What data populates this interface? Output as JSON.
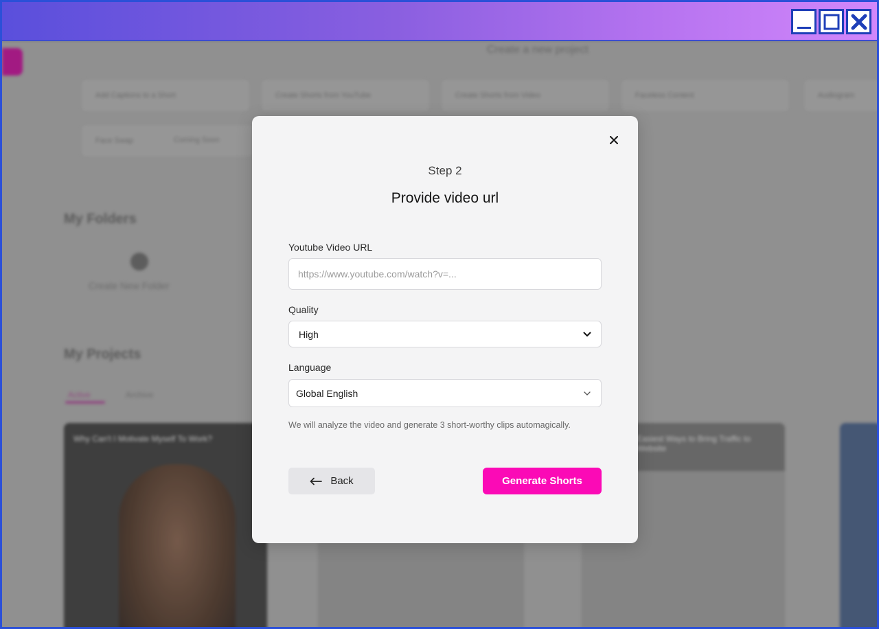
{
  "window": {
    "controls": [
      "minimize-icon",
      "maximize-icon",
      "close-icon"
    ],
    "accent_colors": {
      "titlebar_start": "#5a4fdc",
      "titlebar_end": "#d187fb",
      "border": "#2b50d8"
    }
  },
  "background": {
    "create_title": "Create a new project",
    "chips_row1": [
      "Add Captions to a Short",
      "Create Shorts from YouTube",
      "Create Shorts from Video",
      "Faceless Content",
      "Audiogram"
    ],
    "chips_row2": [
      "Face Swap",
      "Coming Soon"
    ],
    "folders_heading": "My Folders",
    "create_folder": "Create New Folder",
    "projects_heading": "My Projects",
    "tabs": [
      "Active",
      "Archive"
    ],
    "cards": [
      {
        "title": "Why Can't I Motivate Myself To Work?"
      },
      {
        "title": "Easiest Ways to Bring Traffic to Website"
      }
    ]
  },
  "modal": {
    "step": "Step 2",
    "title": "Provide video url",
    "url": {
      "label": "Youtube Video URL",
      "placeholder": "https://www.youtube.com/watch?v=...",
      "value": ""
    },
    "quality": {
      "label": "Quality",
      "value": "High"
    },
    "language": {
      "label": "Language",
      "value": "Global English"
    },
    "hint": "We will analyze the video and generate 3 short-worthy clips automagically.",
    "back_label": "Back",
    "generate_label": "Generate Shorts",
    "accent": "#fb0ab6"
  }
}
